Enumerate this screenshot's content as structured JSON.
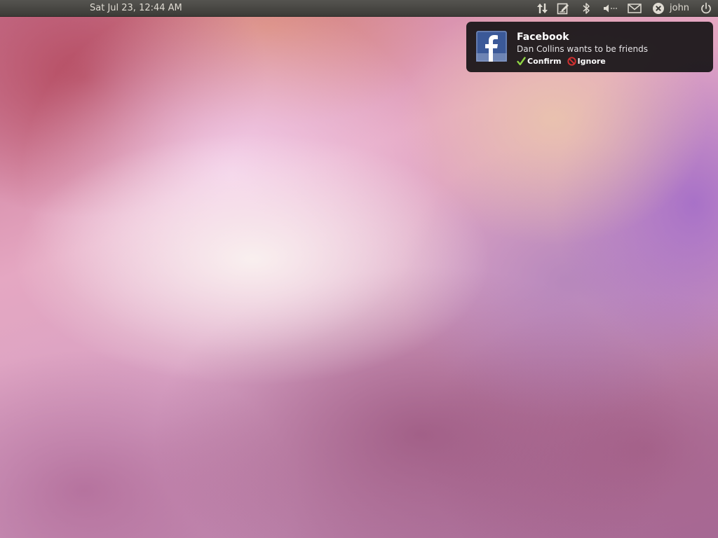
{
  "panel": {
    "clock": "Sat Jul 23, 12:44 AM",
    "username": "john",
    "icons": [
      "network-icon",
      "notes-icon",
      "bluetooth-icon",
      "volume-icon",
      "mail-icon",
      "user-status-icon",
      "power-icon"
    ]
  },
  "notification": {
    "app_icon": "facebook-icon",
    "title": "Facebook",
    "body": "Dan Collins wants to be friends",
    "actions": [
      {
        "label": "Confirm",
        "icon": "checkmark-icon",
        "color": "#8fd444"
      },
      {
        "label": "Ignore",
        "icon": "no-entry-icon",
        "color": "#d43030"
      }
    ]
  },
  "colors": {
    "panel": "#3c3b37",
    "panel_text": "#dfdbd2",
    "facebook_blue": "#3b5998"
  }
}
